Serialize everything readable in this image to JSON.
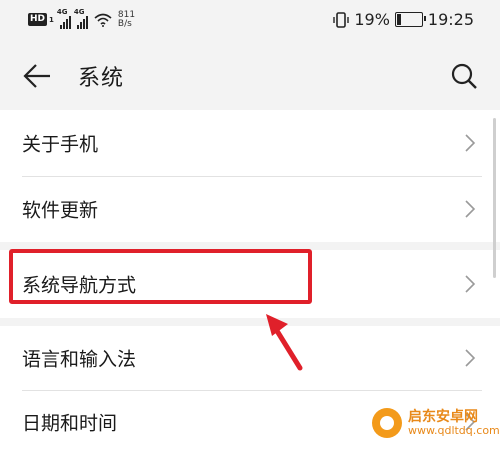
{
  "status_bar": {
    "hd_label": "HD",
    "hd_sub": "1",
    "signal1_label": "4G",
    "signal2_label": "4G",
    "net_speed_value": "811",
    "net_speed_unit": "B/s",
    "battery_percent": "19%",
    "battery_level": 0.19,
    "time": "19:25"
  },
  "app_bar": {
    "title": "系统",
    "back_icon": "back-arrow-icon",
    "search_icon": "search-icon"
  },
  "settings": {
    "group1": [
      {
        "label": "关于手机"
      },
      {
        "label": "软件更新"
      }
    ],
    "group2": [
      {
        "label": "系统导航方式"
      }
    ],
    "group3": [
      {
        "label": "语言和输入法"
      },
      {
        "label": "日期和时间"
      }
    ]
  },
  "annotation": {
    "highlight_color": "#e0202a",
    "arrow_color": "#e0202a"
  },
  "watermark": {
    "line1": "启东安卓网",
    "line2": "www.qdltdq.com"
  }
}
